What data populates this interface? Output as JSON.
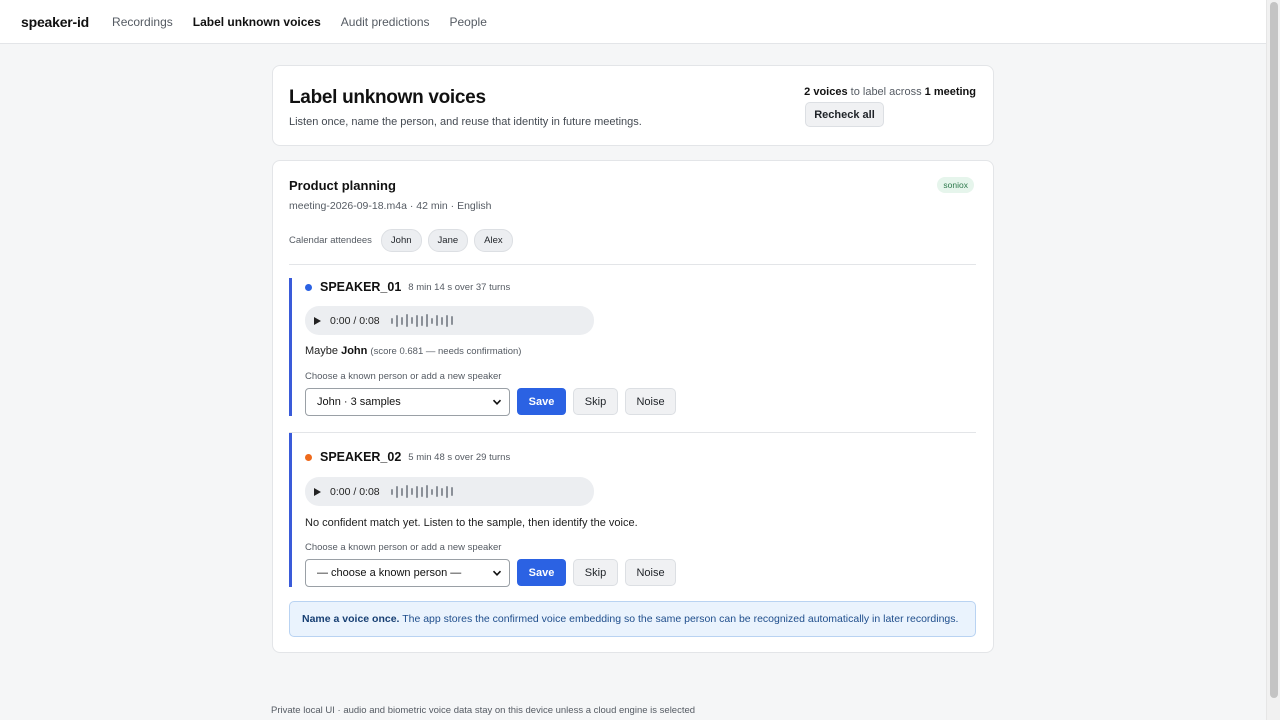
{
  "nav": {
    "brand": "speaker-id",
    "links": [
      "Recordings",
      "Label unknown voices",
      "Audit predictions",
      "People"
    ]
  },
  "header": {
    "title": "Label unknown voices",
    "subtitle": "Listen once, name the person, and reuse that identity in future meetings.",
    "summary_count": "2 voices",
    "summary_mid": " to label across ",
    "summary_meetings": "1 meeting",
    "recheck_label": "Recheck all"
  },
  "meeting": {
    "title": "Product planning",
    "meta": "meeting-2026-09-18.m4a · 42 min · English",
    "engine": "soniox",
    "attendees_label": "Calendar attendees",
    "attendees": [
      "John",
      "Jane",
      "Alex"
    ]
  },
  "speakers": [
    {
      "name": "SPEAKER_01",
      "stats": "8 min 14 s over 37 turns",
      "dot_color": "#2b62e3",
      "time": "0:00 / 0:08",
      "match_prefix": "Maybe ",
      "match_name": "John",
      "match_score": "(score 0.681 — needs confirmation)",
      "choose_label": "Choose a known person or add a new speaker",
      "select_value": "John · 3 samples",
      "save": "Save",
      "skip": "Skip",
      "noise": "Noise"
    },
    {
      "name": "SPEAKER_02",
      "stats": "5 min 48 s over 29 turns",
      "dot_color": "#ee6a1c",
      "time": "0:00 / 0:08",
      "no_match": "No confident match yet. Listen to the sample, then identify the voice.",
      "choose_label": "Choose a known person or add a new speaker",
      "select_value": "— choose a known person —",
      "save": "Save",
      "skip": "Skip",
      "noise": "Noise"
    }
  ],
  "info": {
    "bold": "Name a voice once.",
    "text": " The app stores the confirmed voice embedding so the same person can be recognized automatically in later recordings."
  },
  "footer": "Private local UI · audio and biometric voice data stay on this device unless a cloud engine is selected",
  "colors": {
    "accent": "#2b62e3",
    "speaker_border": "#3a5bd9"
  }
}
